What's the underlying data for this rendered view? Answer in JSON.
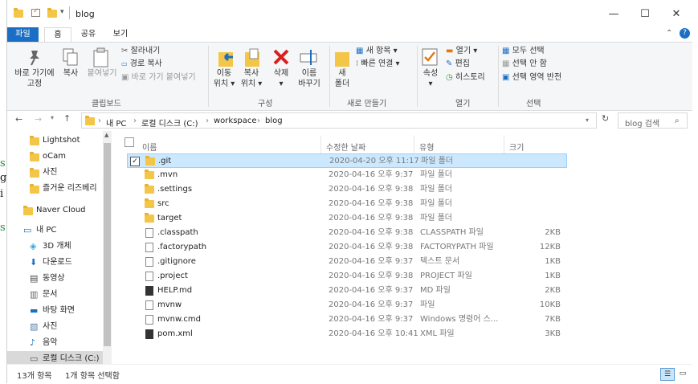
{
  "background_fragments": [
    "s",
    "g",
    "i",
    "s"
  ],
  "window": {
    "title": "blog",
    "controls": {
      "minimize": "—",
      "maximize": "☐",
      "close": "✕"
    },
    "qa_dropdown": "▾"
  },
  "tabs": [
    {
      "label": "파일"
    },
    {
      "label": "홈"
    },
    {
      "label": "공유"
    },
    {
      "label": "보기"
    }
  ],
  "ribbon": {
    "clipboard": {
      "pin_label": "바로 가기에\n고정",
      "copy_label": "복사",
      "paste_label": "붙여넣기",
      "cut_label": "잘라내기",
      "copy_path_label": "경로 복사",
      "paste_shortcut_label": "바로 가기 붙여넣기",
      "group": "클립보드"
    },
    "organize": {
      "move_to": "이동\n위치 ▾",
      "copy_to": "복사\n위치 ▾",
      "delete": "삭제\n▾",
      "rename": "이름\n바꾸기",
      "group": "구성"
    },
    "new": {
      "new_folder": "새\n폴더",
      "new_item": "새 항목 ▾",
      "easy_access": "빠른 연결 ▾",
      "group": "새로 만들기"
    },
    "open": {
      "properties": "속성\n▾",
      "open": "열기 ▾",
      "edit": "편집",
      "history": "히스토리",
      "group": "열기"
    },
    "select": {
      "select_all": "모두 선택",
      "select_none": "선택 안 함",
      "invert": "선택 영역 반전",
      "group": "선택"
    }
  },
  "address": {
    "crumbs": [
      "내 PC",
      "로컬 디스크 (C:)",
      "workspace",
      "blog"
    ],
    "search_placeholder": "blog 검색"
  },
  "nav": {
    "items": [
      {
        "label": "Lightshot",
        "icon": "folder-icon"
      },
      {
        "label": "oCam",
        "icon": "folder-icon"
      },
      {
        "label": "사진",
        "icon": "folder-icon"
      },
      {
        "label": "즐거운 리즈베리",
        "icon": "folder-icon"
      },
      {
        "label": "Naver Cloud",
        "icon": "folder-icon"
      },
      {
        "label": "내 PC",
        "icon": "pc-icon"
      },
      {
        "label": "3D 개체",
        "icon": "cube-icon"
      },
      {
        "label": "다운로드",
        "icon": "download-icon"
      },
      {
        "label": "동영상",
        "icon": "video-icon"
      },
      {
        "label": "문서",
        "icon": "document-icon"
      },
      {
        "label": "바탕 화면",
        "icon": "desktop-icon"
      },
      {
        "label": "사진",
        "icon": "picture-icon"
      },
      {
        "label": "음악",
        "icon": "music-icon"
      },
      {
        "label": "로컬 디스크 (C:)",
        "icon": "drive-icon"
      }
    ]
  },
  "list": {
    "columns": {
      "name": "이름",
      "date": "수정한 날짜",
      "type": "유형",
      "size": "크기"
    },
    "rows": [
      {
        "name": ".git",
        "date": "2020-04-20 오후 11:17",
        "type": "파일 폴더",
        "size": "",
        "icon": "folder"
      },
      {
        "name": ".mvn",
        "date": "2020-04-16 오후 9:37",
        "type": "파일 폴더",
        "size": "",
        "icon": "folder"
      },
      {
        "name": ".settings",
        "date": "2020-04-16 오후 9:38",
        "type": "파일 폴더",
        "size": "",
        "icon": "folder"
      },
      {
        "name": "src",
        "date": "2020-04-16 오후 9:38",
        "type": "파일 폴더",
        "size": "",
        "icon": "folder"
      },
      {
        "name": "target",
        "date": "2020-04-16 오후 9:38",
        "type": "파일 폴더",
        "size": "",
        "icon": "folder"
      },
      {
        "name": ".classpath",
        "date": "2020-04-16 오후 9:38",
        "type": "CLASSPATH 파일",
        "size": "2KB",
        "icon": "doc"
      },
      {
        "name": ".factorypath",
        "date": "2020-04-16 오후 9:38",
        "type": "FACTORYPATH 파일",
        "size": "12KB",
        "icon": "doc"
      },
      {
        "name": ".gitignore",
        "date": "2020-04-16 오후 9:37",
        "type": "텍스트 문서",
        "size": "1KB",
        "icon": "doc"
      },
      {
        "name": ".project",
        "date": "2020-04-16 오후 9:38",
        "type": "PROJECT 파일",
        "size": "1KB",
        "icon": "doc"
      },
      {
        "name": "HELP.md",
        "date": "2020-04-16 오후 9:37",
        "type": "MD 파일",
        "size": "2KB",
        "icon": "docdark"
      },
      {
        "name": "mvnw",
        "date": "2020-04-16 오후 9:37",
        "type": "파일",
        "size": "10KB",
        "icon": "doc"
      },
      {
        "name": "mvnw.cmd",
        "date": "2020-04-16 오후 9:37",
        "type": "Windows 명령어 스...",
        "size": "7KB",
        "icon": "doc"
      },
      {
        "name": "pom.xml",
        "date": "2020-04-16 오후 10:41",
        "type": "XML 파일",
        "size": "3KB",
        "icon": "docdark"
      }
    ]
  },
  "status": {
    "count": "13개 항목",
    "selected": "1개 항목 선택함"
  }
}
